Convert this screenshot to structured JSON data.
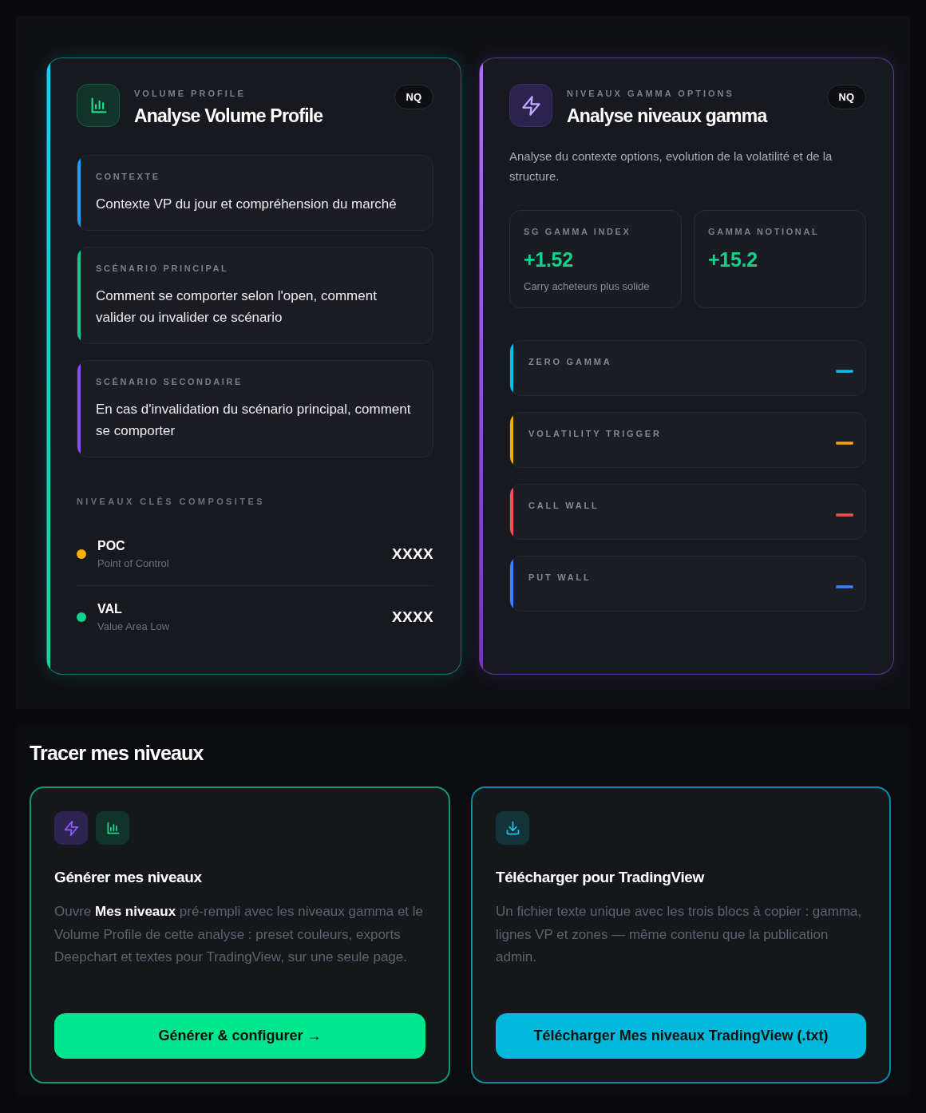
{
  "analysis_cards": [
    {
      "kind": "volume_profile",
      "overline": "VOLUME PROFILE",
      "title": "Analyse Volume Profile",
      "badge": "NQ",
      "blocks": [
        {
          "label": "CONTEXTE",
          "text": "Contexte VP du jour et compréhension du marché",
          "color": "#1a9dff"
        },
        {
          "label": "SCÉNARIO PRINCIPAL",
          "text": "Comment se comporter selon l'open, comment valider ou invalider ce scénario",
          "color": "#10c98a"
        },
        {
          "label": "SCÉNARIO SECONDAIRE",
          "text": "En cas d'invalidation du scénario principal, comment se comporter",
          "color": "#8b4cf6"
        }
      ],
      "key_levels": {
        "heading": "NIVEAUX CLÉS COMPOSITES",
        "items": [
          {
            "name": "POC",
            "description": "Point of Control",
            "value": "XXXX",
            "color": "#f5b000"
          },
          {
            "name": "VAL",
            "description": "Value Area Low",
            "value": "XXXX",
            "color": "#10d48e"
          }
        ]
      }
    },
    {
      "kind": "gamma",
      "overline": "NIVEAUX GAMMA OPTIONS",
      "title": "Analyse niveaux gamma",
      "badge": "NQ",
      "description": "Analyse du contexte options, evolution de la volatilité et de la structure.",
      "metrics": [
        {
          "label": "SG GAMMA INDEX",
          "value": "+1.52",
          "note": "Carry acheteurs plus solide"
        },
        {
          "label": "GAMMA NOTIONAL",
          "value": "+15.2"
        }
      ],
      "levels": [
        {
          "label": "ZERO GAMMA",
          "value": "—",
          "color": "#00bff5"
        },
        {
          "label": "VOLATILITY TRIGGER",
          "value": "—",
          "color": "#f5a800"
        },
        {
          "label": "CALL WALL",
          "value": "—",
          "color": "#f0505a"
        },
        {
          "label": "PUT WALL",
          "value": "—",
          "color": "#2f86ff"
        }
      ]
    }
  ],
  "plot_section": {
    "title": "Tracer mes niveaux",
    "cards": [
      {
        "kind": "generate",
        "title": "Générer mes niveaux",
        "description": "Ouvre **Mes niveaux** pré-rempli avec les niveaux gamma et le Volume Profile de cette analyse : preset couleurs, exports Deepchart et textes pour TradingView, sur une seule page.",
        "button": "Générer & configurer →"
      },
      {
        "kind": "download",
        "title": "Télécharger pour TradingView",
        "description": "Un fichier texte unique avec les trois blocs à copier : gamma, lignes VP et zones — même contenu que la publication admin.",
        "button": "Télécharger Mes niveaux TradingView (.txt)"
      }
    ]
  }
}
